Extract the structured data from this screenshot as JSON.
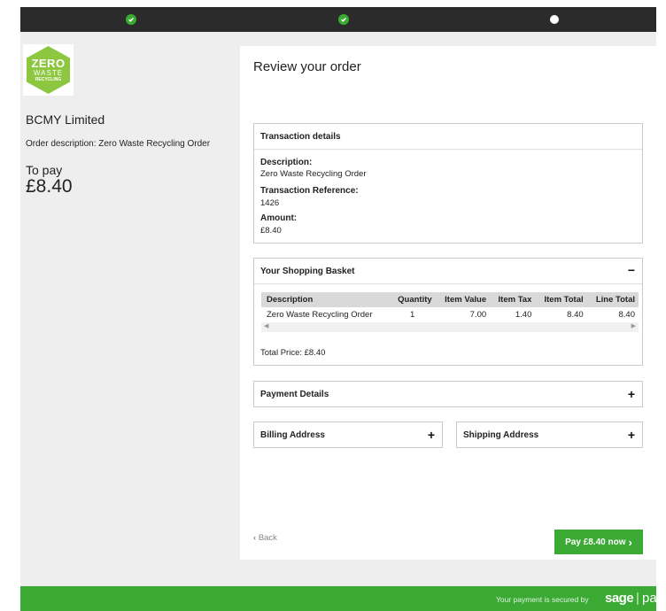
{
  "progress": {
    "steps": [
      {
        "state": "done",
        "icon": "check-icon"
      },
      {
        "state": "done",
        "icon": "check-icon"
      },
      {
        "state": "current",
        "icon": "dot-icon"
      }
    ]
  },
  "merchant": {
    "logo": {
      "line1": "ZERO",
      "line2": "WASTE",
      "line3": "RECYCLING",
      "color": "#8dc63f"
    },
    "name": "BCMY Limited",
    "order_description": "Order description: Zero Waste Recycling Order",
    "to_pay_label": "To pay",
    "to_pay_amount": "£8.40"
  },
  "main": {
    "title": "Review your order",
    "transaction": {
      "header": "Transaction details",
      "description_label": "Description:",
      "description_value": "Zero Waste Recycling Order",
      "reference_label": "Transaction Reference:",
      "reference_value": "1426",
      "amount_label": "Amount:",
      "amount_value": "£8.40"
    },
    "basket": {
      "header": "Your Shopping Basket",
      "toggle": "−",
      "columns": [
        "Description",
        "Quantity",
        "Item Value",
        "Item Tax",
        "Item Total",
        "Line Total"
      ],
      "rows": [
        [
          "Zero Waste Recycling Order",
          "1",
          "7.00",
          "1.40",
          "8.40",
          "8.40"
        ]
      ],
      "total_price": "Total Price: £8.40"
    },
    "payment_details": {
      "header": "Payment Details",
      "toggle": "+"
    },
    "billing_address": {
      "header": "Billing Address",
      "toggle": "+"
    },
    "shipping_address": {
      "header": "Shipping Address",
      "toggle": "+"
    },
    "back_label": "Back",
    "pay_button_label": "Pay £8.40 now"
  },
  "footer": {
    "secured_text": "Your payment is secured by",
    "brand_sage": "sage",
    "brand_sep": "|",
    "brand_pay": "pay"
  },
  "colors": {
    "accent_green": "#3aaa35",
    "progress_bar": "#2b2b2b",
    "logo_green": "#8dc63f"
  }
}
